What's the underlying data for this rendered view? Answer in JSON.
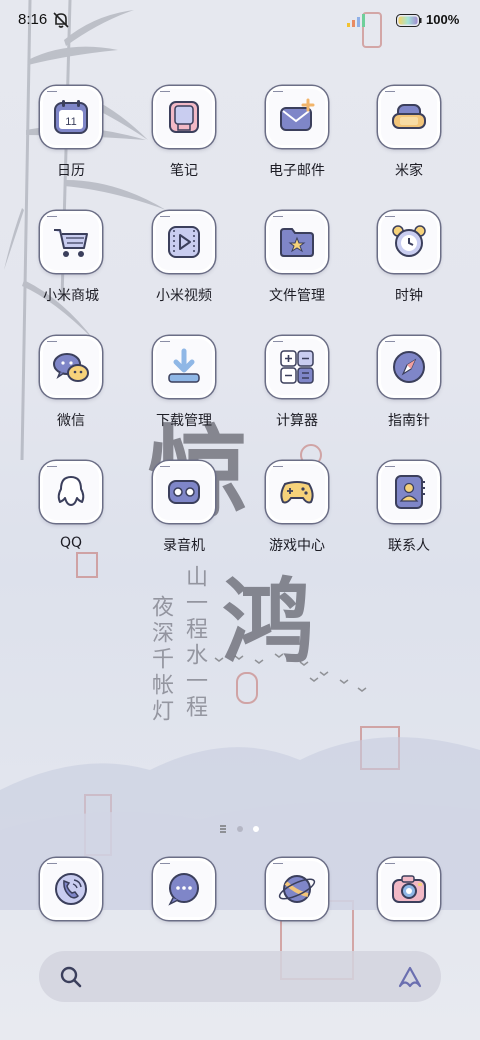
{
  "status_bar": {
    "time": "8:16",
    "battery_percent": "100%",
    "icons": [
      "bell-muted-icon",
      "signal-icon",
      "battery-icon"
    ]
  },
  "apps": [
    {
      "label": "日历",
      "icon": "calendar-icon",
      "badge": "11"
    },
    {
      "label": "笔记",
      "icon": "notes-icon"
    },
    {
      "label": "电子邮件",
      "icon": "mail-icon"
    },
    {
      "label": "米家",
      "icon": "sofa-icon"
    },
    {
      "label": "小米商城",
      "icon": "shopping-cart-icon"
    },
    {
      "label": "小米视频",
      "icon": "video-play-icon"
    },
    {
      "label": "文件管理",
      "icon": "folder-star-icon"
    },
    {
      "label": "时钟",
      "icon": "alarm-clock-icon"
    },
    {
      "label": "微信",
      "icon": "wechat-icon"
    },
    {
      "label": "下载管理",
      "icon": "download-icon"
    },
    {
      "label": "计算器",
      "icon": "calculator-icon"
    },
    {
      "label": "指南针",
      "icon": "compass-icon"
    },
    {
      "label": "QQ",
      "icon": "qq-penguin-icon"
    },
    {
      "label": "录音机",
      "icon": "recorder-icon"
    },
    {
      "label": "游戏中心",
      "icon": "gamepad-icon"
    },
    {
      "label": "联系人",
      "icon": "contacts-book-icon"
    }
  ],
  "dock": [
    {
      "icon": "phone-icon"
    },
    {
      "icon": "message-icon"
    },
    {
      "icon": "browser-planet-icon"
    },
    {
      "icon": "camera-icon"
    }
  ],
  "page_indicator": {
    "pages": 3,
    "current": 3
  },
  "search_bar": {
    "icons": [
      "search-icon",
      "assistant-icon"
    ]
  },
  "colors": {
    "accent": "#7f86c8",
    "accent_light": "#c9cdf0",
    "frame": "#6b6e86"
  }
}
